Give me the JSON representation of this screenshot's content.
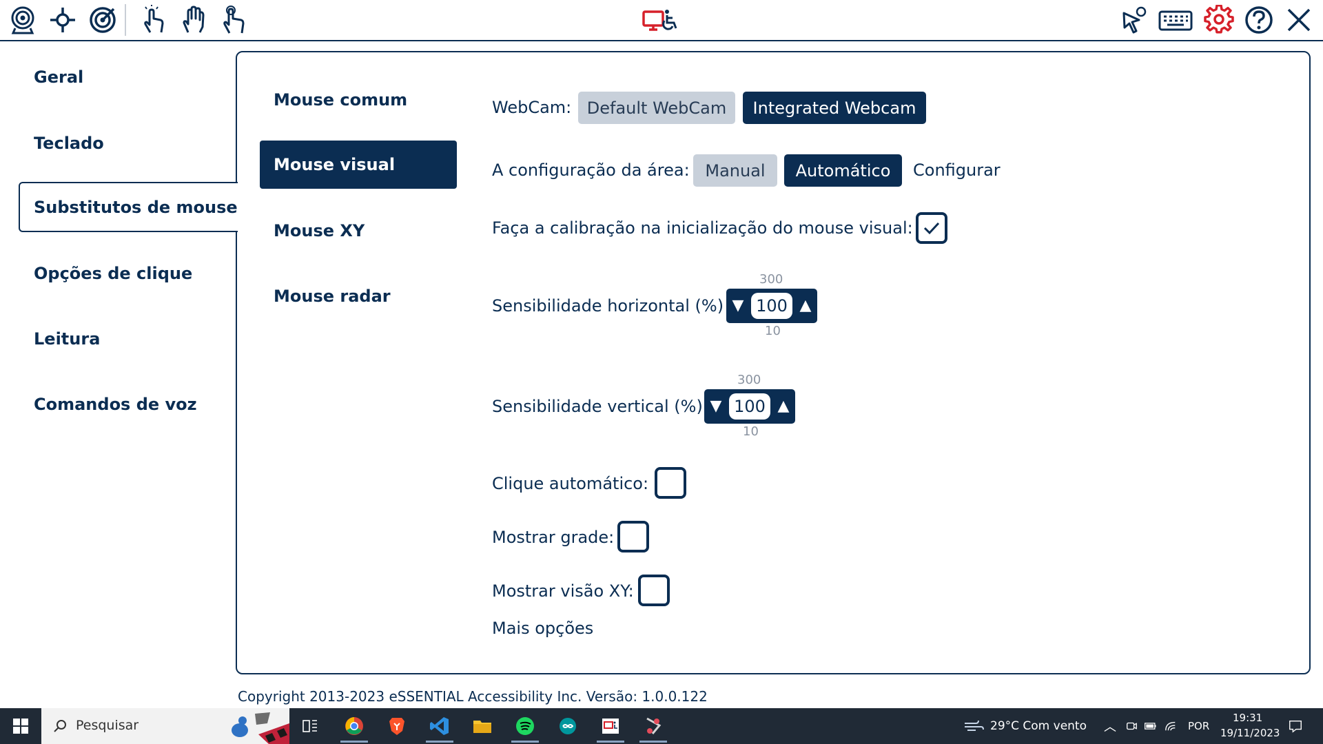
{
  "toolbar": {
    "left_icons": [
      "webcam-icon",
      "crosshair-icon",
      "target-icon",
      "hand-tap-icon",
      "hand-open-icon",
      "hand-point-icon"
    ],
    "center_icon": "monitor-accessibility-icon",
    "right_icons": [
      "cursor-radar-icon",
      "keyboard-icon",
      "settings-gear-icon",
      "help-icon",
      "close-icon"
    ],
    "accent_color": "#0b2d52",
    "logo_color": "#d6202a"
  },
  "nav": {
    "items": [
      {
        "label": "Geral"
      },
      {
        "label": "Teclado"
      },
      {
        "label": "Substitutos de mouse"
      },
      {
        "label": "Opções de clique"
      },
      {
        "label": "Leitura"
      },
      {
        "label": "Comandos de voz"
      }
    ],
    "active_index": 2
  },
  "subnav": {
    "items": [
      {
        "label": "Mouse comum"
      },
      {
        "label": "Mouse visual"
      },
      {
        "label": "Mouse XY"
      },
      {
        "label": "Mouse radar"
      }
    ],
    "active_index": 1
  },
  "settings": {
    "webcam_label": "WebCam:",
    "webcam_options": [
      "Default WebCam",
      "Integrated Webcam"
    ],
    "webcam_selected": "Integrated Webcam",
    "area_label": "A configuração da área:",
    "area_options": [
      "Manual",
      "Automático"
    ],
    "area_selected": "Automático",
    "configure_link": "Configurar",
    "calibration_label": "Faça a calibração na inicialização do mouse visual:",
    "calibration_checked": true,
    "h_sens_label": "Sensibilidade horizontal (%)",
    "h_sens_value": "100",
    "h_sens_max": "300",
    "h_sens_min": "10",
    "v_sens_label": "Sensibilidade vertical (%)",
    "v_sens_value": "100",
    "v_sens_max": "300",
    "v_sens_min": "10",
    "auto_click_label": "Clique automático:",
    "auto_click_checked": false,
    "show_grid_label": "Mostrar grade:",
    "show_grid_checked": false,
    "show_xy_label": "Mostrar visão XY:",
    "show_xy_checked": false,
    "more_options_link": "Mais opções"
  },
  "footer": {
    "copyright": "Copyright 2013-2023 eSSENTIAL Accessibility Inc.  Versão: 1.0.0.122"
  },
  "taskbar": {
    "search_placeholder": "Pesquisar",
    "apps": [
      "task-view-icon",
      "chrome-icon",
      "brave-icon",
      "vscode-icon",
      "file-explorer-icon",
      "spotify-icon",
      "arduino-icon",
      "essential-accessibility-icon",
      "snipping-tool-icon"
    ],
    "weather": "29°C  Com vento",
    "language": "POR",
    "time": "19:31",
    "date": "19/11/2023"
  }
}
